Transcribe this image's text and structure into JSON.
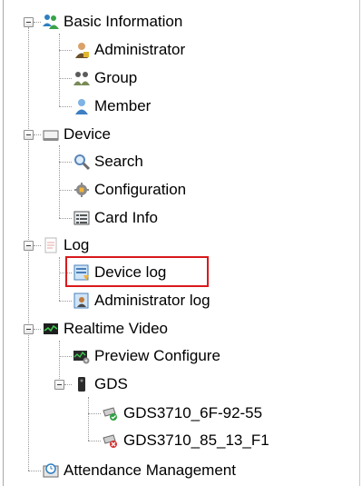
{
  "tree": {
    "nodes": [
      {
        "label": "Basic Information",
        "icon": "people-group-icon"
      },
      {
        "label": "Administrator",
        "icon": "administrator-user-icon"
      },
      {
        "label": "Group",
        "icon": "group-users-icon"
      },
      {
        "label": "Member",
        "icon": "member-user-icon"
      },
      {
        "label": "Device",
        "icon": "device-icon"
      },
      {
        "label": "Search",
        "icon": "search-magnifier-icon"
      },
      {
        "label": "Configuration",
        "icon": "gear-icon"
      },
      {
        "label": "Card Info",
        "icon": "card-list-icon"
      },
      {
        "label": "Log",
        "icon": "log-document-icon"
      },
      {
        "label": "Device log",
        "icon": "device-log-icon"
      },
      {
        "label": "Administrator log",
        "icon": "admin-log-icon"
      },
      {
        "label": "Realtime Video",
        "icon": "video-monitor-icon"
      },
      {
        "label": "Preview Configure",
        "icon": "preview-configure-icon"
      },
      {
        "label": "GDS",
        "icon": "gds-device-icon"
      },
      {
        "label": "GDS3710_6F-92-55",
        "icon": "camera-online-icon"
      },
      {
        "label": "GDS3710_85_13_F1",
        "icon": "camera-offline-icon"
      },
      {
        "label": "Attendance Management",
        "icon": "attendance-clock-icon"
      }
    ],
    "selected": "Device log"
  }
}
